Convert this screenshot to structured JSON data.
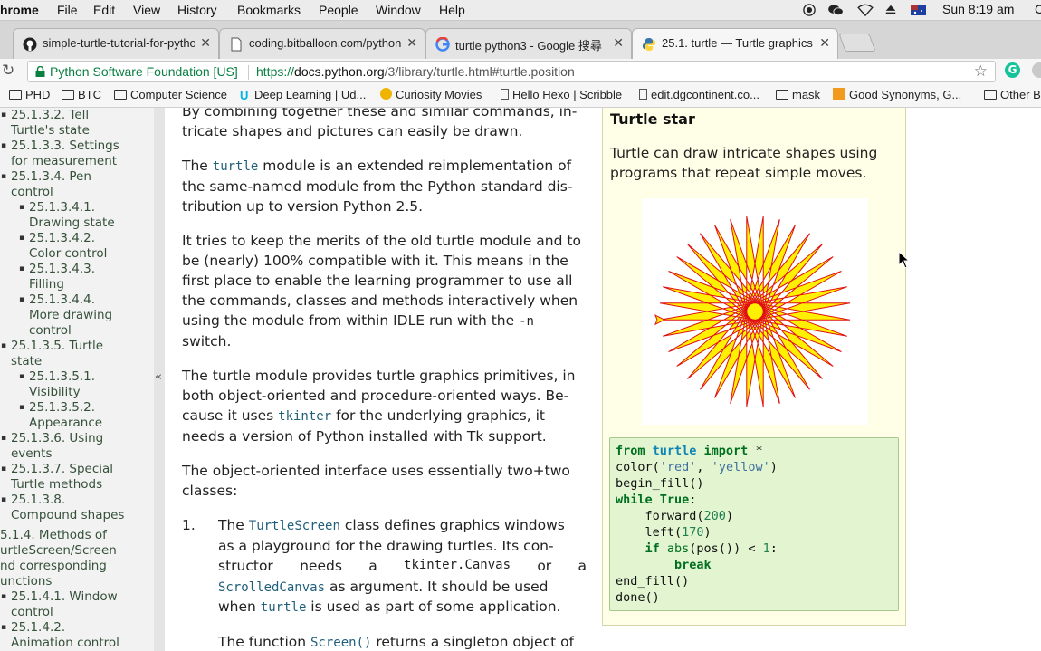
{
  "menubar": {
    "app": "hrome",
    "items": [
      "File",
      "Edit",
      "View",
      "History",
      "Bookmarks",
      "People",
      "Window",
      "Help"
    ],
    "clock": "Sun 8:19 am",
    "trailing": "C"
  },
  "tabs": [
    {
      "title": "simple-turtle-tutorial-for-pytho",
      "icon": "github-icon"
    },
    {
      "title": "coding.bitballoon.com/python...",
      "icon": "page-icon"
    },
    {
      "title": "turtle python3 - Google 搜尋",
      "icon": "google-icon"
    },
    {
      "title": "25.1. turtle — Turtle graphics –",
      "icon": "python-icon"
    }
  ],
  "address": {
    "secure_label": "Python Software Foundation [US]",
    "url_scheme": "https://",
    "url_host": "docs.python.org",
    "url_path": "/3/library/turtle.html#turtle.position"
  },
  "bookmarks": [
    {
      "label": "PHD",
      "icon": "folder"
    },
    {
      "label": "BTC",
      "icon": "folder"
    },
    {
      "label": "Computer Science",
      "icon": "folder"
    },
    {
      "label": "Deep Learning | Ud...",
      "icon": "udacity"
    },
    {
      "label": "Curiosity Movies",
      "icon": "curiosity"
    },
    {
      "label": "Hello Hexo | Scribble",
      "icon": "page"
    },
    {
      "label": "edit.dgcontinent.co...",
      "icon": "page"
    },
    {
      "label": "mask",
      "icon": "folder"
    },
    {
      "label": "Good Synonyms, G...",
      "icon": "thesaurus"
    },
    {
      "label": "Other B",
      "icon": "folder"
    }
  ],
  "sidebar": [
    {
      "text": "25.1.3.2. Tell",
      "level": 1
    },
    {
      "text": "Turtle's state",
      "level": 1
    },
    {
      "text": "25.1.3.3. Settings",
      "level": 1
    },
    {
      "text": "for measurement",
      "level": 1
    },
    {
      "text": "25.1.3.4. Pen",
      "level": 1
    },
    {
      "text": "control",
      "level": 1
    },
    {
      "text": "25.1.3.4.1.",
      "level": 2
    },
    {
      "text": "Drawing state",
      "level": 2
    },
    {
      "text": "25.1.3.4.2.",
      "level": 2
    },
    {
      "text": "Color control",
      "level": 2
    },
    {
      "text": "25.1.3.4.3.",
      "level": 2
    },
    {
      "text": "Filling",
      "level": 2
    },
    {
      "text": "25.1.3.4.4.",
      "level": 2
    },
    {
      "text": "More drawing",
      "level": 2
    },
    {
      "text": "control",
      "level": 2
    },
    {
      "text": "25.1.3.5. Turtle",
      "level": 1
    },
    {
      "text": "state",
      "level": 1
    },
    {
      "text": "25.1.3.5.1.",
      "level": 2
    },
    {
      "text": "Visibility",
      "level": 2
    },
    {
      "text": "25.1.3.5.2.",
      "level": 2
    },
    {
      "text": "Appearance",
      "level": 2
    },
    {
      "text": "25.1.3.6. Using",
      "level": 1
    },
    {
      "text": "events",
      "level": 1
    },
    {
      "text": "25.1.3.7. Special",
      "level": 1
    },
    {
      "text": "Turtle methods",
      "level": 1
    },
    {
      "text": "25.1.3.8.",
      "level": 1
    },
    {
      "text": "Compound shapes",
      "level": 1
    },
    {
      "text": "5.1.4. Methods of",
      "level": 0
    },
    {
      "text": "urtleScreen/Screen",
      "level": 0
    },
    {
      "text": "nd corresponding",
      "level": 0
    },
    {
      "text": "unctions",
      "level": 0
    },
    {
      "text": "25.1.4.1. Window",
      "level": 1
    },
    {
      "text": "control",
      "level": 1
    },
    {
      "text": "25.1.4.2.",
      "level": 1
    },
    {
      "text": "Animation control",
      "level": 1
    }
  ],
  "collapse_glyph": "«",
  "main": {
    "p0": [
      "By combining together these and similar commands, in-",
      "tricate shapes and pictures can easily be drawn."
    ],
    "p1": {
      "l1_pre": "The ",
      "l1_code": "turtle",
      "l1_post": " module is an extended reimplementation of",
      "l2": "the same-named module from the Python standard dis-",
      "l3": "tribution up to version Python 2.5."
    },
    "p2": {
      "l1": "It tries to keep the merits of the old turtle module and to",
      "l2": "be (nearly) 100% compatible with it. This means in the",
      "l3": "first place to enable the learning programmer to use all",
      "l4": "the commands, classes and methods interactively when",
      "l5_pre": "using the module from within IDLE run with the ",
      "l5_code": "-n",
      "l6": "switch."
    },
    "p3": {
      "l1": "The turtle module provides turtle graphics primitives, in",
      "l2": "both object-oriented and procedure-oriented ways. Be-",
      "l3_pre": "cause it uses ",
      "l3_code": "tkinter",
      "l3_post": " for the underlying graphics, it",
      "l4": "needs a version of Python installed with Tk support."
    },
    "p4": [
      "The object-oriented interface uses essentially two+two",
      "classes:"
    ],
    "li1": {
      "num": "1.",
      "l1_pre": "The ",
      "l1_code": "TurtleScreen",
      "l1_post": " class defines graphics windows",
      "l2": "as a playground for the drawing turtles. Its con-",
      "l3_a": "structor",
      "l3_b": "needs",
      "l3_c": "a",
      "l3_code": "tkinter.Canvas",
      "l3_d": "or",
      "l3_e": "a",
      "l4_code": "ScrolledCanvas",
      "l4_post": " as argument. It should be used",
      "l5_pre": "when ",
      "l5_code": "turtle",
      "l5_post": " is used as part of some application."
    },
    "li1_p2": {
      "pre": "The function ",
      "code": "Screen()",
      "post": " returns a singleton object of"
    }
  },
  "aside": {
    "title": "Turtle star",
    "desc": [
      "Turtle can draw intricate shapes using",
      "programs that repeat simple moves."
    ],
    "star_colors": {
      "stroke": "#e01010",
      "fill": "#ffef00"
    },
    "code": [
      [
        {
          "t": "from ",
          "c": "kw"
        },
        {
          "t": "turtle ",
          "c": "nm"
        },
        {
          "t": "import ",
          "c": "kw"
        },
        {
          "t": "*",
          "c": ""
        }
      ],
      [
        {
          "t": "color(",
          "c": ""
        },
        {
          "t": "'red'",
          "c": "str"
        },
        {
          "t": ", ",
          "c": ""
        },
        {
          "t": "'yellow'",
          "c": "str"
        },
        {
          "t": ")",
          "c": ""
        }
      ],
      [
        {
          "t": "begin_fill()",
          "c": ""
        }
      ],
      [
        {
          "t": "while ",
          "c": "kw"
        },
        {
          "t": "True",
          "c": "kw"
        },
        {
          "t": ":",
          "c": ""
        }
      ],
      [
        {
          "t": "    forward(",
          "c": ""
        },
        {
          "t": "200",
          "c": "num"
        },
        {
          "t": ")",
          "c": ""
        }
      ],
      [
        {
          "t": "    left(",
          "c": ""
        },
        {
          "t": "170",
          "c": "num"
        },
        {
          "t": ")",
          "c": ""
        }
      ],
      [
        {
          "t": "    ",
          "c": ""
        },
        {
          "t": "if ",
          "c": "kw"
        },
        {
          "t": "abs",
          "c": "fn"
        },
        {
          "t": "(pos()) < ",
          "c": ""
        },
        {
          "t": "1",
          "c": "num"
        },
        {
          "t": ":",
          "c": ""
        }
      ],
      [
        {
          "t": "        ",
          "c": ""
        },
        {
          "t": "break",
          "c": "kw"
        }
      ],
      [
        {
          "t": "end_fill()",
          "c": ""
        }
      ],
      [
        {
          "t": "done()",
          "c": ""
        }
      ]
    ]
  }
}
